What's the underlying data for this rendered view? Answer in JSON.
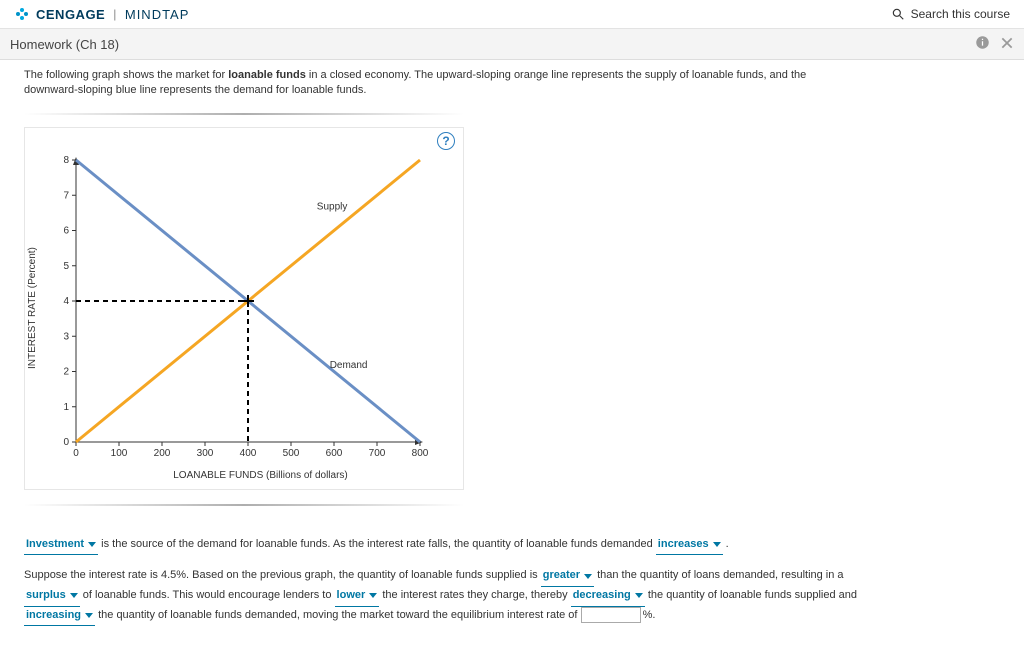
{
  "header": {
    "brand1": "CENGAGE",
    "brand2": "MINDTAP",
    "search_label": "Search this course"
  },
  "subheader": {
    "title": "Homework (Ch 18)"
  },
  "intro": {
    "pre": "The following graph shows the market for ",
    "bold": "loanable funds",
    "post": " in a closed economy. The upward-sloping orange line represents the supply of loanable funds, and the downward-sloping blue line represents the demand for loanable funds."
  },
  "chart_data": {
    "type": "line",
    "title": "",
    "xlabel": "LOANABLE FUNDS (Billions of dollars)",
    "ylabel": "INTEREST RATE (Percent)",
    "xlim": [
      0,
      800
    ],
    "ylim": [
      0,
      8
    ],
    "xticks": [
      0,
      100,
      200,
      300,
      400,
      500,
      600,
      700,
      800
    ],
    "yticks": [
      0,
      1,
      2,
      3,
      4,
      5,
      6,
      7,
      8
    ],
    "series": [
      {
        "name": "Supply",
        "color": "#f5a623",
        "points": [
          [
            0,
            0
          ],
          [
            800,
            8
          ]
        ]
      },
      {
        "name": "Demand",
        "color": "#6a8fc5",
        "points": [
          [
            0,
            8
          ],
          [
            800,
            0
          ]
        ]
      }
    ],
    "annotations": [
      {
        "text": "Supply",
        "x": 560,
        "y": 6.6
      },
      {
        "text": "Demand",
        "x": 590,
        "y": 2.1
      }
    ],
    "equilibrium": {
      "x": 400,
      "y": 4
    }
  },
  "answers": {
    "p1_dd1": "Investment",
    "p1_text1": "is the source of the demand for loanable funds. As the interest rate falls, the quantity of loanable funds demanded",
    "p1_dd2": "increases",
    "p2_pre": "Suppose the interest rate is 4.5%. Based on the previous graph, the quantity of loanable funds supplied is",
    "p2_dd1": "greater",
    "p2_mid1": "than the quantity of loans demanded, resulting in a",
    "p2_dd2": "surplus",
    "p2_mid2": "of loanable funds. This would encourage lenders to",
    "p2_dd3": "lower",
    "p2_mid3": "the interest rates they charge, thereby",
    "p2_dd4": "decreasing",
    "p2_mid4": "the quantity of loanable funds supplied and",
    "p2_dd5": "increasing",
    "p2_mid5": "the quantity of loanable funds demanded, moving the market toward the equilibrium interest rate of",
    "p2_unit": "%",
    "p2_end": "."
  },
  "help": "?"
}
